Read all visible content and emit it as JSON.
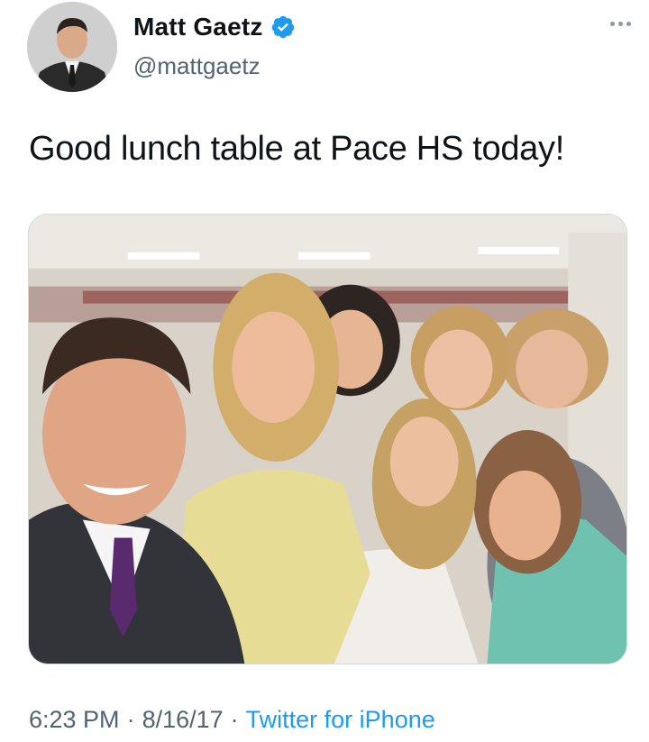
{
  "user": {
    "display_name": "Matt Gaetz",
    "handle": "@mattgaetz",
    "verified": true,
    "avatar_icon": "profile-photo"
  },
  "tweet": {
    "text": "Good lunch table at Pace HS today!"
  },
  "media": {
    "type": "photo",
    "description_icon": "group-selfie-photo"
  },
  "meta": {
    "time": "6:23 PM",
    "separator": "·",
    "date": "8/16/17",
    "source": "Twitter for iPhone"
  },
  "colors": {
    "text": "#0f1419",
    "secondary": "#536471",
    "link": "#1d9bf0",
    "verified": "#1d9bf0"
  }
}
